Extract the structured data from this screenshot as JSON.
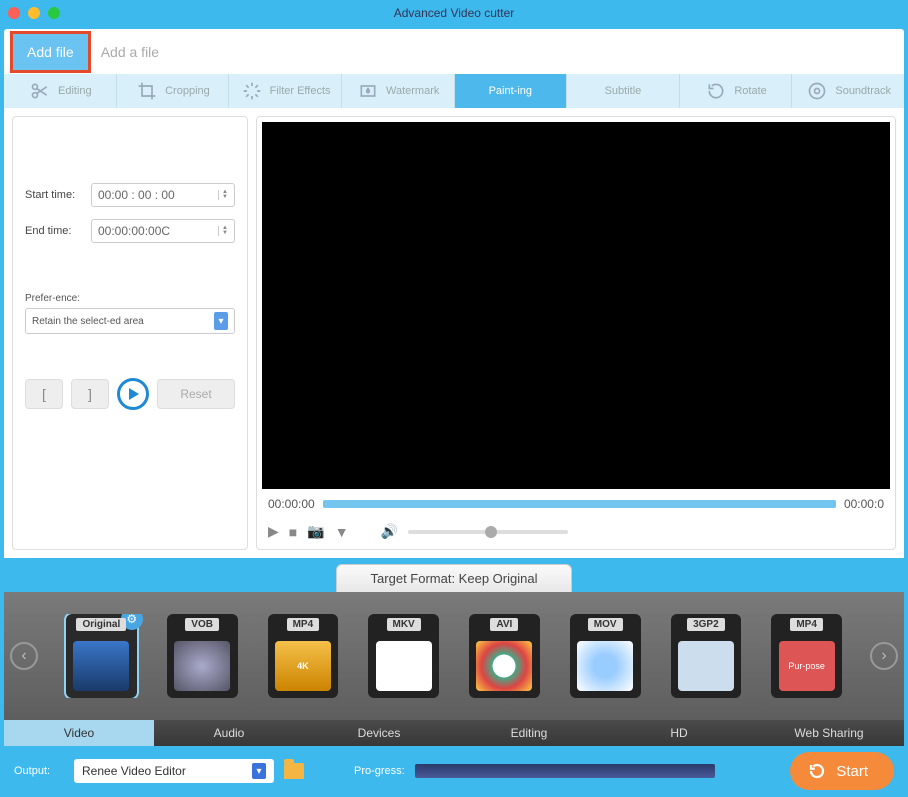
{
  "window": {
    "title": "Advanced Video cutter"
  },
  "toolbar": {
    "add_file_label": "Add file",
    "placeholder": "Add a file"
  },
  "tabs": {
    "editing": "Editing",
    "cropping": "Cropping",
    "filter": "Filter Effects",
    "watermark": "Watermark",
    "painting": "Paint-ing",
    "subtitle": "Subtitle",
    "rotate": "Rotate",
    "soundtrack": "Soundtrack"
  },
  "left": {
    "start_label": "Start time:",
    "start_value": "00:00   : 00    : 00",
    "end_label": "End time:",
    "end_value": "00:00:00:00C",
    "pref_label": "Prefer-ence:",
    "pref_value": "Retain the select-ed area",
    "mark_in": "[",
    "mark_out": "]",
    "reset": "Reset"
  },
  "player": {
    "pos": "00:00:00",
    "dur": "00:00:0"
  },
  "target": {
    "label": "Target Format: Keep Original"
  },
  "formats": {
    "original": "Original",
    "vob": "VOB",
    "mp4": "MP4",
    "mkv": "MKV",
    "avi": "AVI",
    "mov": "MOV",
    "3gp2": "3GP2",
    "mp4_purpose_top": "MP4",
    "mp4_purpose": "Pur-pose",
    "fourk": "4K"
  },
  "categories": {
    "video": "Video",
    "audio": "Audio",
    "devices": "Devices",
    "editing": "Editing",
    "hd": "HD",
    "web": "Web Sharing"
  },
  "footer": {
    "output_label": "Output:",
    "output_value": "Renee Video Editor",
    "progress_label": "Pro-gress:",
    "start": "Start"
  }
}
